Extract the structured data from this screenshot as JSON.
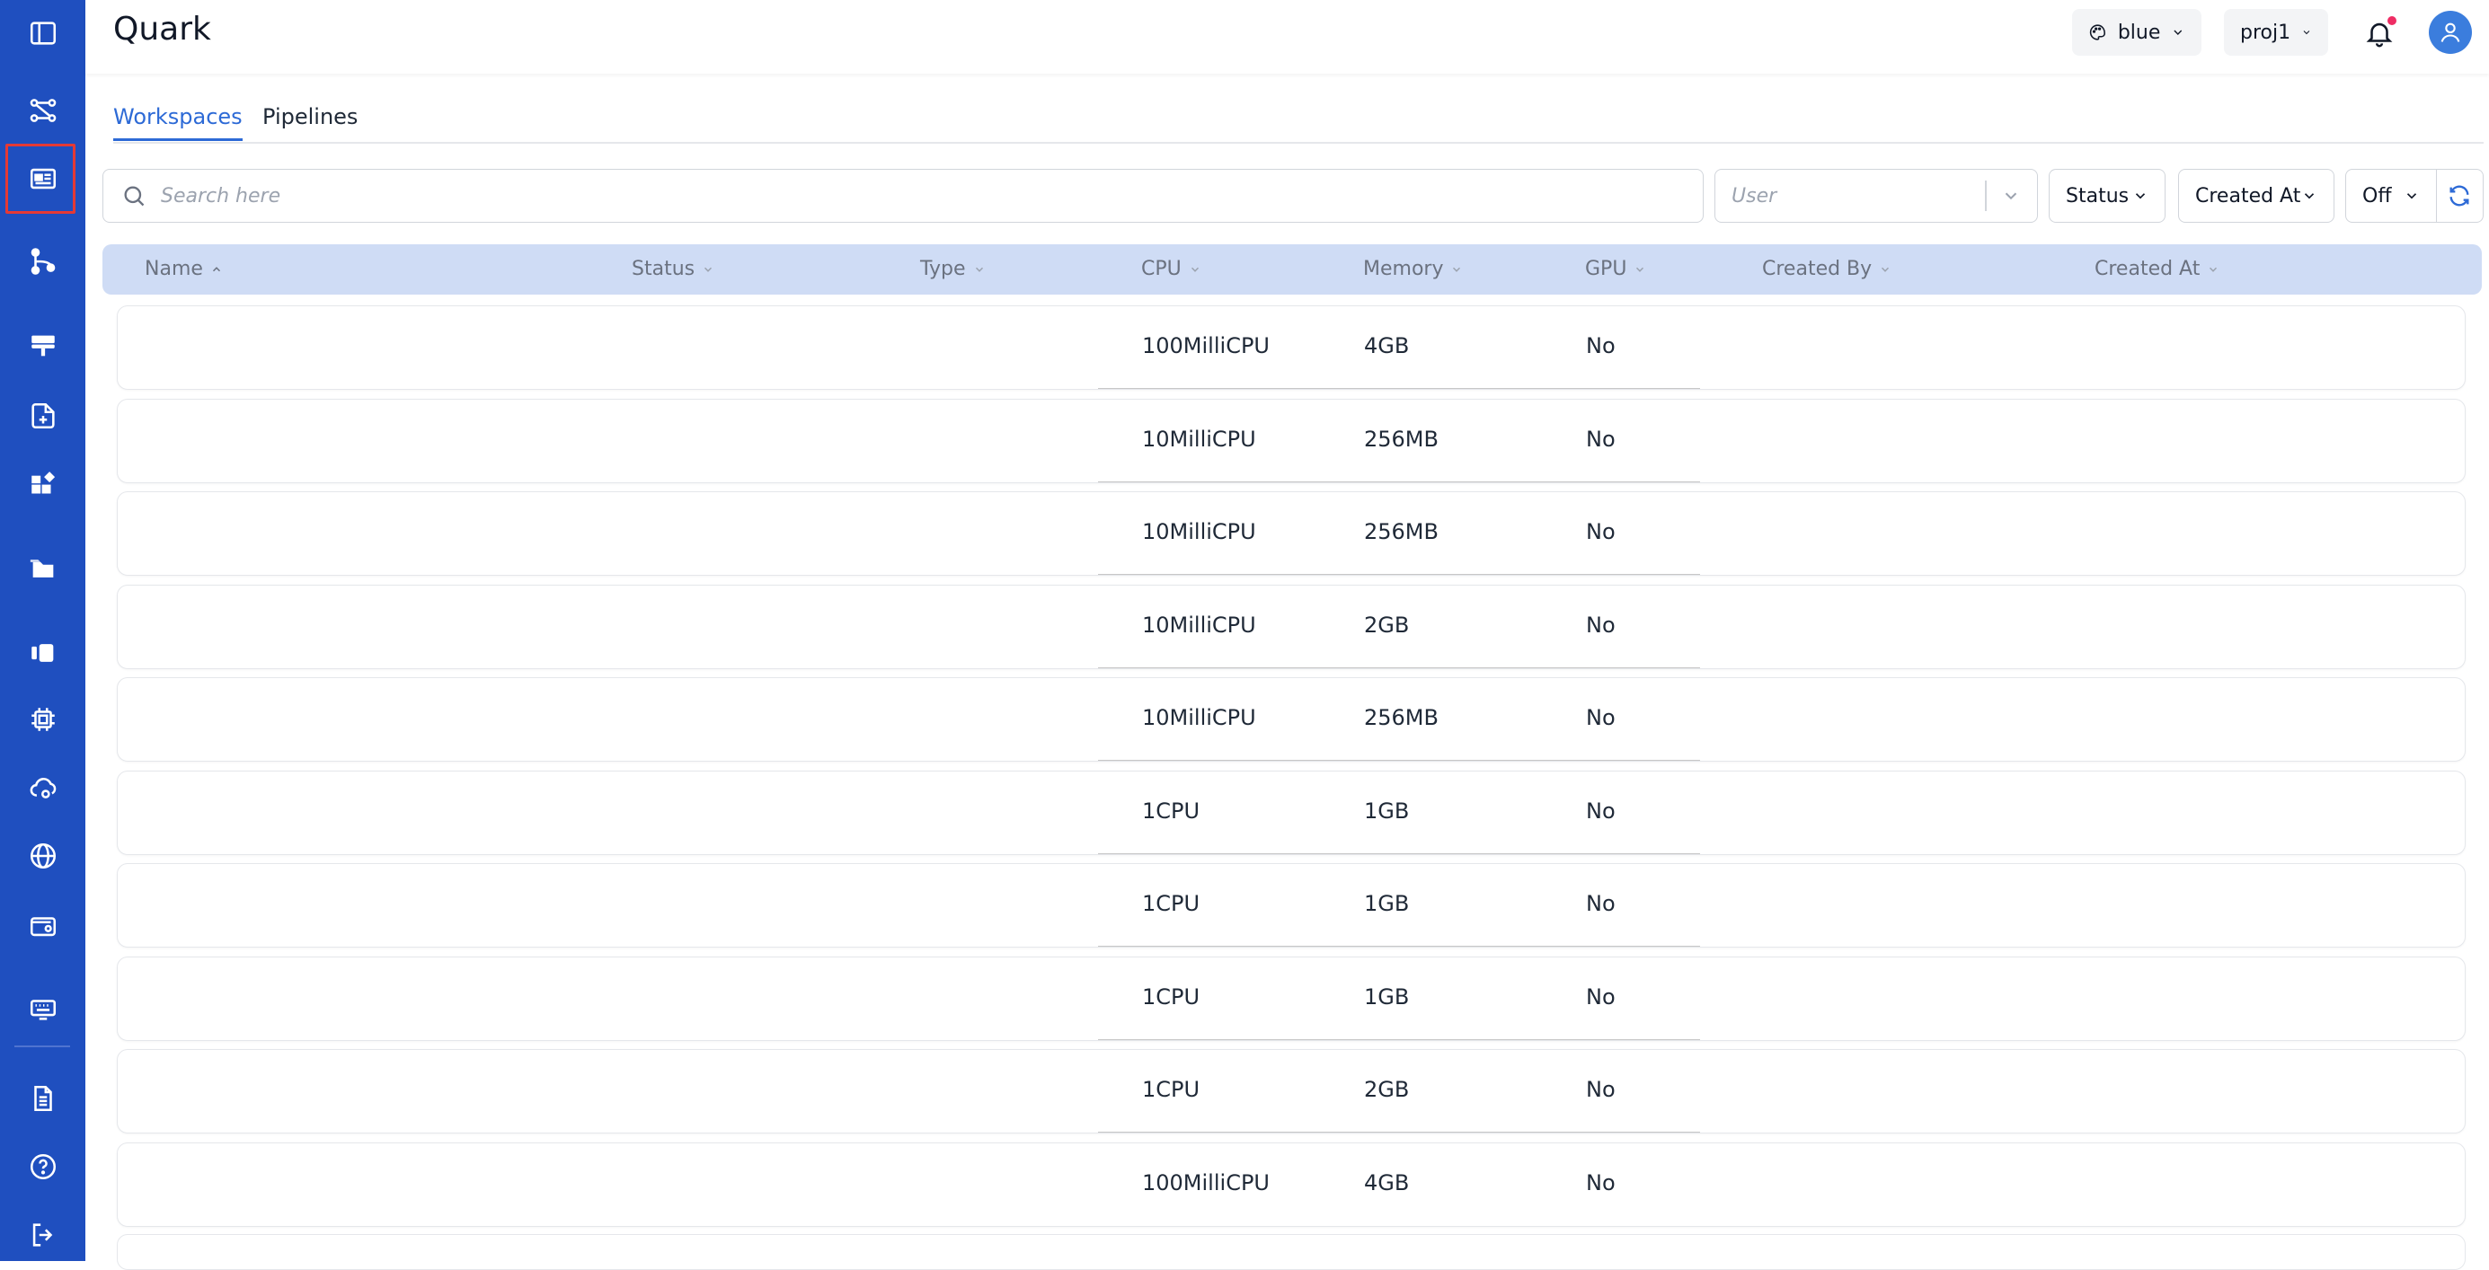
{
  "app": {
    "title": "Quark"
  },
  "header": {
    "theme": {
      "label": "blue",
      "icon": "palette-icon"
    },
    "project": {
      "label": "proj1"
    },
    "notifications_icon": "bell-icon",
    "avatar_icon": "user-icon"
  },
  "sidebar": {
    "items": [
      {
        "name": "sidebar-toggle",
        "icon": "panel-icon"
      },
      {
        "name": "pipelines",
        "icon": "flow-icon"
      },
      {
        "name": "workspaces",
        "icon": "workspace-card-icon",
        "active": true
      },
      {
        "name": "branches",
        "icon": "branch-icon"
      },
      {
        "name": "servers",
        "icon": "server-icon"
      },
      {
        "name": "new-file",
        "icon": "file-plus-icon"
      },
      {
        "name": "apps",
        "icon": "widgets-icon"
      },
      {
        "name": "folders",
        "icon": "folder-icon"
      },
      {
        "name": "volumes",
        "icon": "volumes-icon"
      },
      {
        "name": "compute",
        "icon": "chip-icon"
      },
      {
        "name": "cloud-settings",
        "icon": "cloud-gear-icon"
      },
      {
        "name": "network",
        "icon": "globe-icon"
      },
      {
        "name": "billing",
        "icon": "wallet-icon"
      },
      {
        "name": "keyboard",
        "icon": "keyboard-icon"
      },
      {
        "name": "docs",
        "icon": "document-icon"
      },
      {
        "name": "help",
        "icon": "help-icon"
      },
      {
        "name": "logout",
        "icon": "logout-icon"
      }
    ]
  },
  "tabs": [
    {
      "label": "Workspaces",
      "active": true
    },
    {
      "label": "Pipelines",
      "active": false
    }
  ],
  "filters": {
    "search_placeholder": "Search here",
    "user_placeholder": "User",
    "status_label": "Status",
    "created_at_label": "Created At",
    "auto_refresh_label": "Off"
  },
  "table": {
    "columns": [
      "Name",
      "Status",
      "Type",
      "CPU",
      "Memory",
      "GPU",
      "Created By",
      "Created At"
    ],
    "sort": {
      "column": "Name",
      "direction": "asc"
    },
    "rows": [
      {
        "name": "",
        "status": "",
        "type": "",
        "cpu": "100MilliCPU",
        "memory": "4GB",
        "gpu": "No",
        "created_by": "",
        "created_at": ""
      },
      {
        "name": "",
        "status": "",
        "type": "",
        "cpu": "10MilliCPU",
        "memory": "256MB",
        "gpu": "No",
        "created_by": "",
        "created_at": ""
      },
      {
        "name": "",
        "status": "",
        "type": "",
        "cpu": "10MilliCPU",
        "memory": "256MB",
        "gpu": "No",
        "created_by": "",
        "created_at": ""
      },
      {
        "name": "",
        "status": "",
        "type": "",
        "cpu": "10MilliCPU",
        "memory": "2GB",
        "gpu": "No",
        "created_by": "",
        "created_at": ""
      },
      {
        "name": "",
        "status": "",
        "type": "",
        "cpu": "10MilliCPU",
        "memory": "256MB",
        "gpu": "No",
        "created_by": "",
        "created_at": ""
      },
      {
        "name": "",
        "status": "",
        "type": "",
        "cpu": "1CPU",
        "memory": "1GB",
        "gpu": "No",
        "created_by": "",
        "created_at": ""
      },
      {
        "name": "",
        "status": "",
        "type": "",
        "cpu": "1CPU",
        "memory": "1GB",
        "gpu": "No",
        "created_by": "",
        "created_at": ""
      },
      {
        "name": "",
        "status": "",
        "type": "",
        "cpu": "1CPU",
        "memory": "1GB",
        "gpu": "No",
        "created_by": "",
        "created_at": ""
      },
      {
        "name": "",
        "status": "",
        "type": "",
        "cpu": "1CPU",
        "memory": "2GB",
        "gpu": "No",
        "created_by": "",
        "created_at": ""
      },
      {
        "name": "",
        "status": "",
        "type": "",
        "cpu": "100MilliCPU",
        "memory": "4GB",
        "gpu": "No",
        "created_by": "",
        "created_at": ""
      }
    ]
  },
  "colors": {
    "sidebar_bg": "#1f4fbf",
    "accent": "#2d6ad6",
    "table_header_bg": "#cfdcf5",
    "active_highlight": "#e53935",
    "notification_dot": "#ef2d64"
  }
}
